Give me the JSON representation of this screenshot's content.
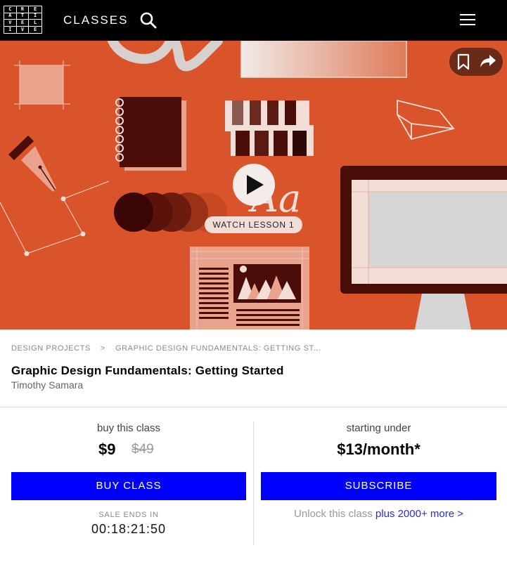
{
  "header": {
    "logo_letters": [
      "C",
      "R",
      "E",
      "A",
      "T",
      "I",
      "V",
      "E",
      "L",
      "I",
      "V",
      "E"
    ],
    "nav_label": "CLASSES"
  },
  "hero": {
    "watch_label": "WATCH LESSON 1",
    "art_text": "Aa"
  },
  "breadcrumb": {
    "items": [
      "DESIGN PROJECTS",
      "GRAPHIC DESIGN FUNDAMENTALS: GETTING ST..."
    ],
    "separator": ">"
  },
  "course": {
    "title": "Graphic Design Fundamentals: Getting Started",
    "instructor": "Timothy Samara"
  },
  "purchase": {
    "buy_label": "buy this class",
    "price": "$9",
    "original_price": "$49",
    "buy_button": "BUY CLASS",
    "sale_label": "SALE ENDS IN",
    "countdown": "00:18:21:50"
  },
  "subscription": {
    "label": "starting under",
    "price": "$13/month*",
    "button": "SUBSCRIBE",
    "unlock_text": "Unlock this class",
    "unlock_link": "plus 2000+ more >"
  },
  "colors": {
    "hero_bg": "#d9542b",
    "accent_blue": "#0000ff",
    "dark_brown": "#4a0d08",
    "header_bg": "#000000"
  }
}
